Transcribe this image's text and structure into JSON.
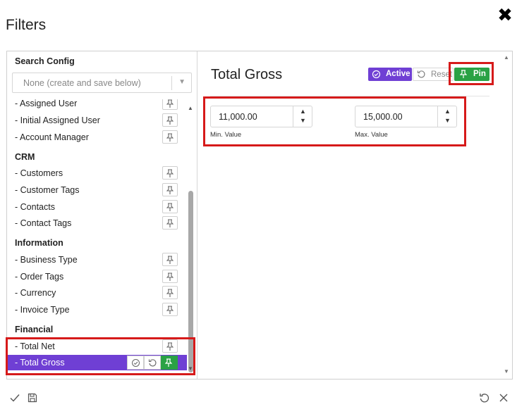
{
  "dialog": {
    "title": "Filters",
    "close_glyph": "✖"
  },
  "search_config": {
    "label": "Search Config",
    "select_value": "None (create and save below)"
  },
  "filter_list": {
    "rows": [
      {
        "label": "- Assigned User"
      },
      {
        "label": "- Initial Assigned User"
      },
      {
        "label": "- Account Manager"
      }
    ],
    "sections": [
      {
        "heading": "CRM",
        "items": [
          "- Customers",
          "- Customer Tags",
          "- Contacts",
          "- Contact Tags"
        ]
      },
      {
        "heading": "Information",
        "items": [
          "- Business Type",
          "- Order Tags",
          "- Currency",
          "- Invoice Type"
        ]
      },
      {
        "heading": "Financial",
        "items": [
          "- Total Net",
          "- Total Gross"
        ]
      }
    ],
    "active_item": "- Total Gross"
  },
  "detail": {
    "title": "Total Gross",
    "active_label": "Active",
    "reset_label": "Reset",
    "pin_label": "Pin",
    "min": {
      "value": "11,000.00",
      "caption": "Min. Value"
    },
    "max": {
      "value": "15,000.00",
      "caption": "Max. Value"
    }
  },
  "colors": {
    "accent_purple": "#6f3fd4",
    "pin_green": "#2aa245",
    "highlight_red": "#d61a1a"
  },
  "icons": {
    "pin": "pin-icon",
    "check_circle": "check-circle-icon",
    "reset": "reset-icon",
    "close": "close-icon",
    "checkmark": "checkmark-icon",
    "save": "save-icon",
    "undo": "undo-icon"
  }
}
